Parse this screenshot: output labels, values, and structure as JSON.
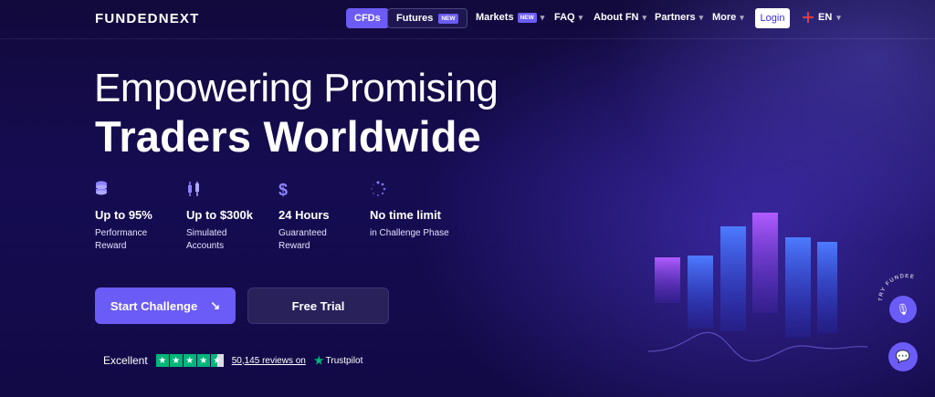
{
  "brand": {
    "logo": "FUNDEDNEXT"
  },
  "nav": {
    "cfds": "CFDs",
    "futures": "Futures",
    "futures_badge": "NEW",
    "markets": "Markets",
    "markets_badge": "NEW",
    "faq": "FAQ",
    "about": "About FN",
    "partners": "Partners",
    "more": "More",
    "login": "Login",
    "lang": "EN"
  },
  "hero": {
    "line1": "Empowering Promising",
    "line2": "Traders Worldwide"
  },
  "features": [
    {
      "icon": "coins-stack-icon",
      "title": "Up to 95%",
      "sub1": "Performance",
      "sub2": "Reward"
    },
    {
      "icon": "candlestick-icon",
      "title": "Up to $300k",
      "sub1": "Simulated",
      "sub2": "Accounts"
    },
    {
      "icon": "dollar-icon",
      "title": "24 Hours",
      "sub1": "Guaranteed",
      "sub2": "Reward"
    },
    {
      "icon": "spinner-icon",
      "title": "No time limit",
      "sub1": "in Challenge Phase",
      "sub2": ""
    }
  ],
  "cta": {
    "start": "Start Challenge",
    "trial": "Free Trial"
  },
  "trustpilot": {
    "rating_word": "Excellent",
    "stars": 4.5,
    "reviews": "50,145 reviews on",
    "brand": "Trustpilot"
  },
  "widget": {
    "ring_text": "TRY FUNDEE"
  },
  "colors": {
    "accent": "#6b5cf8",
    "trustpilot_green": "#00b67a",
    "bg": "#150c52"
  }
}
